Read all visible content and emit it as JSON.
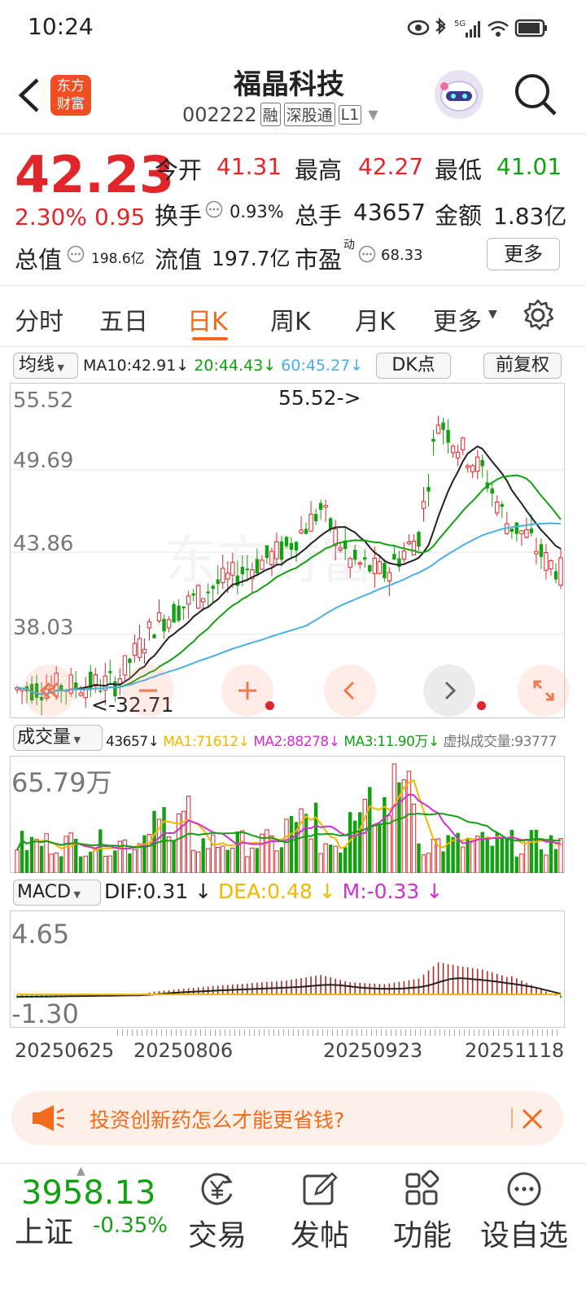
{
  "status_bar": {
    "time": "10:24",
    "net": "5G"
  },
  "header": {
    "logo_line1": "东方",
    "logo_line2": "财富",
    "title": "福晶科技",
    "code": "002222",
    "tags": [
      "融",
      "深股通",
      "L1"
    ]
  },
  "quote": {
    "price": "42.23",
    "change_pct": "2.30%",
    "change": "0.95",
    "open_label": "今开",
    "open": "41.31",
    "high_label": "最高",
    "high": "42.27",
    "low_label": "最低",
    "low": "41.01",
    "turnover_label": "换手",
    "turnover": "0.93%",
    "volume_label": "总手",
    "volume": "43657",
    "amount_label": "金额",
    "amount": "1.83亿",
    "mktcap_label": "总值",
    "mktcap": "198.6亿",
    "float_label": "流值",
    "float": "197.7亿",
    "pe_label": "市盈",
    "pe_sup": "动",
    "pe": "68.33",
    "more": "更多"
  },
  "tabs": [
    "分时",
    "五日",
    "日K",
    "周K",
    "月K",
    "更多"
  ],
  "kline": {
    "ma_selector": "均线",
    "ma10": "MA10:42.91",
    "ma20": "20:44.43",
    "ma60": "60:45.27",
    "dk_button": "DK点",
    "adjust_button": "前复权",
    "y_labels": [
      "55.52",
      "49.69",
      "43.86",
      "38.03"
    ],
    "max_annot": "55.52->",
    "min_annot": "<-32.71"
  },
  "volume": {
    "selector": "成交量",
    "vol": "43657",
    "ma1": "MA1:71612",
    "ma2": "MA2:88278",
    "ma3": "MA3:11.90万",
    "virtual": "虚拟成交量:93777",
    "y_label": "65.79万"
  },
  "macd": {
    "selector": "MACD",
    "dif": "DIF:0.31",
    "dea": "DEA:0.48",
    "m": "M:-0.33",
    "y_top": "4.65",
    "y_bottom": "-1.30"
  },
  "dates": [
    "20250625",
    "20250806",
    "20250923",
    "20251118"
  ],
  "banner": {
    "text": "投资创新药怎么才能更省钱?"
  },
  "bottom_nav": {
    "index_value": "3958.13",
    "index_name": "上证",
    "index_change": "-0.35%",
    "items": [
      "交易",
      "发帖",
      "功能",
      "设自选"
    ]
  },
  "colors": {
    "up": "#e0262b",
    "down": "#13a013",
    "accent": "#f26b1d"
  }
}
